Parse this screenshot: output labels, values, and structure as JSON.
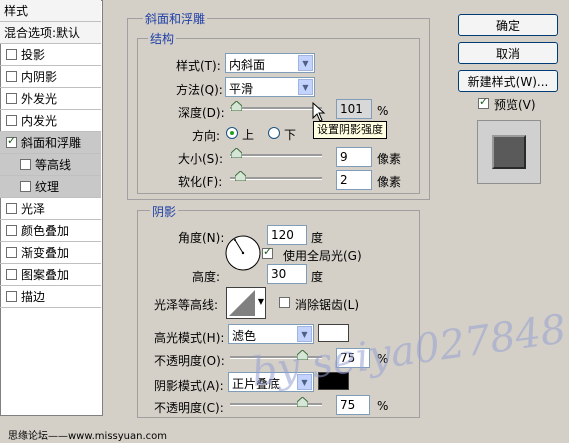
{
  "colors": {
    "dialog_bg": "#d4d0c8",
    "group_title": "#1f3fa6",
    "accent_check": "#21a121"
  },
  "style_list": {
    "header": "样式",
    "blend_options": "混合选项:默认",
    "items": [
      {
        "label": "投影",
        "checked": false,
        "selected": false,
        "sub": false
      },
      {
        "label": "内阴影",
        "checked": false,
        "selected": false,
        "sub": false
      },
      {
        "label": "外发光",
        "checked": false,
        "selected": false,
        "sub": false
      },
      {
        "label": "内发光",
        "checked": false,
        "selected": false,
        "sub": false
      },
      {
        "label": "斜面和浮雕",
        "checked": true,
        "selected": true,
        "sub": false
      },
      {
        "label": "等高线",
        "checked": false,
        "selected": false,
        "sub": true
      },
      {
        "label": "纹理",
        "checked": false,
        "selected": false,
        "sub": true
      },
      {
        "label": "光泽",
        "checked": false,
        "selected": false,
        "sub": false
      },
      {
        "label": "颜色叠加",
        "checked": false,
        "selected": false,
        "sub": false
      },
      {
        "label": "渐变叠加",
        "checked": false,
        "selected": false,
        "sub": false
      },
      {
        "label": "图案叠加",
        "checked": false,
        "selected": false,
        "sub": false
      },
      {
        "label": "描边",
        "checked": false,
        "selected": false,
        "sub": false
      }
    ]
  },
  "bevel": {
    "section_title": "斜面和浮雕",
    "structure_title": "结构",
    "style_label": "样式(T):",
    "style_value": "内斜面",
    "technique_label": "方法(Q):",
    "technique_value": "平滑",
    "depth_label": "深度(D):",
    "depth_value": "101",
    "depth_unit": "%",
    "direction_label": "方向:",
    "direction_up": "上",
    "direction_down": "下",
    "size_label": "大小(S):",
    "size_value": "9",
    "size_unit": "像素",
    "soften_label": "软化(F):",
    "soften_value": "2",
    "soften_unit": "像素",
    "tooltip": "设置阴影强度"
  },
  "shading": {
    "title": "阴影",
    "angle_label": "角度(N):",
    "angle_value": "120",
    "angle_unit": "度",
    "global_light_label": "使用全局光(G)",
    "altitude_label": "高度:",
    "altitude_value": "30",
    "altitude_unit": "度",
    "gloss_contour_label": "光泽等高线:",
    "anti_alias_label": "消除锯齿(L)",
    "highlight_mode_label": "高光模式(H):",
    "highlight_mode_value": "滤色",
    "highlight_opacity_label": "不透明度(O):",
    "highlight_opacity_value": "75",
    "shadow_mode_label": "阴影模式(A):",
    "shadow_mode_value": "正片叠底",
    "shadow_opacity_label": "不透明度(C):",
    "shadow_opacity_value": "75",
    "opacity_unit": "%"
  },
  "buttons": {
    "ok": "确定",
    "cancel": "取消",
    "new_style": "新建样式(W)...",
    "preview": "预览(V)"
  },
  "watermark": "by seiya027848",
  "footer": "思缘论坛——www.missyuan.com"
}
